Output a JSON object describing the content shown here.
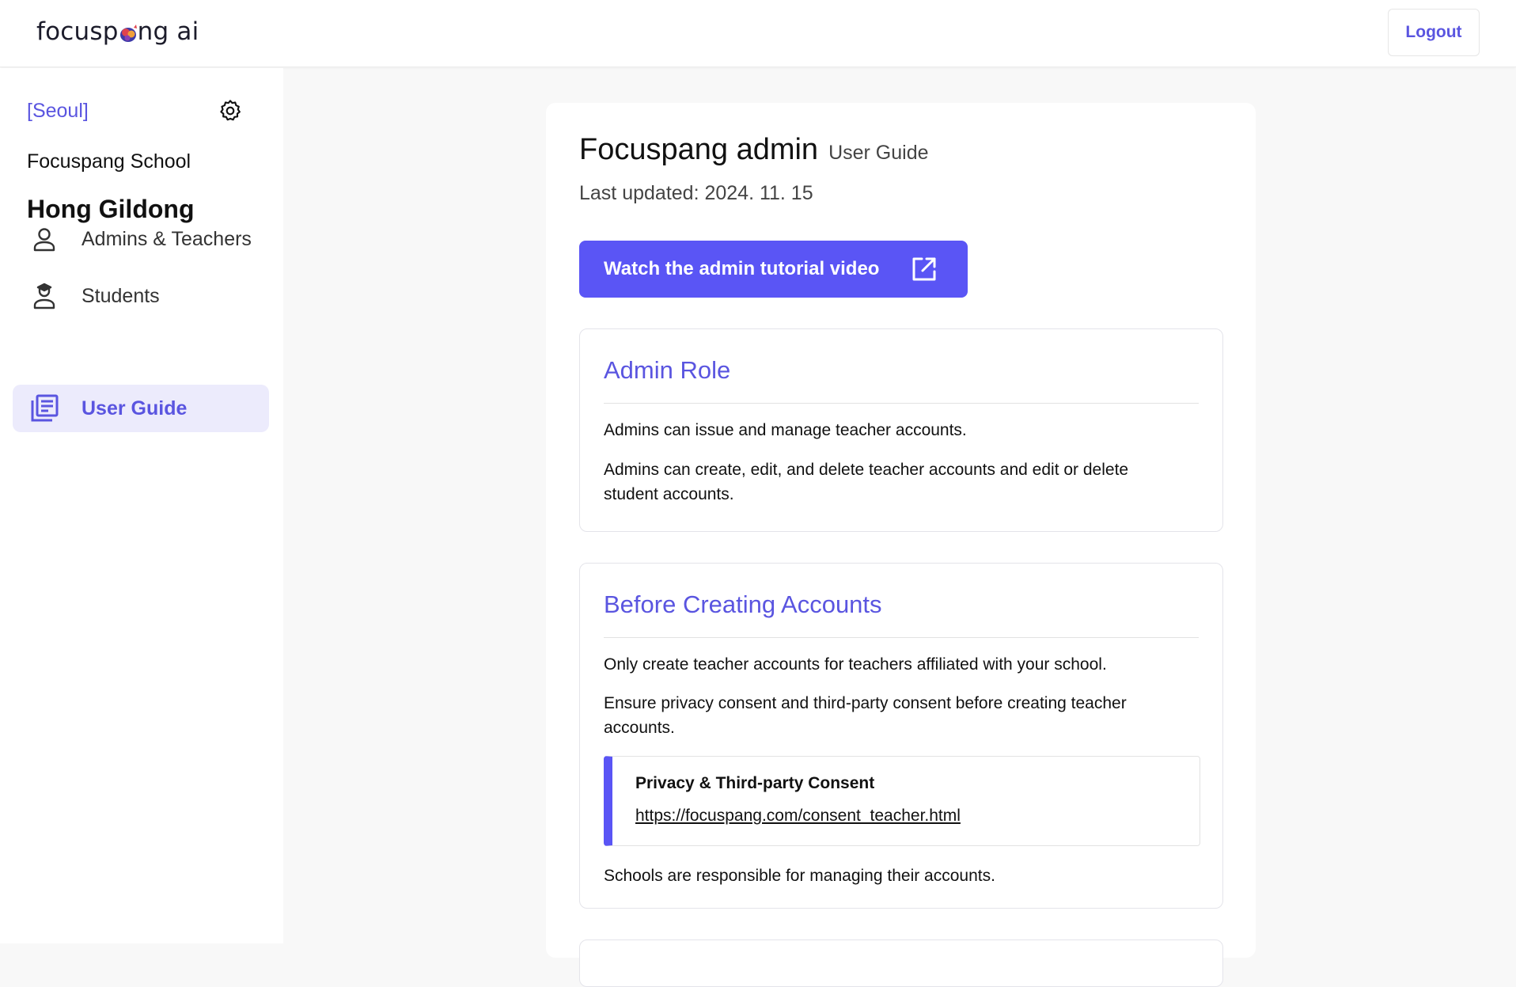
{
  "colors": {
    "accent": "#5a55f5",
    "accent_text": "#5a55e0",
    "active_bg": "#ecebfc",
    "page_bg": "#f8f8f8"
  },
  "header": {
    "logo_text_before": "focusp",
    "logo_text_after": "ng ai",
    "logout_label": "Logout"
  },
  "sidebar": {
    "region": "[Seoul]",
    "settings_icon": "gear-icon",
    "school_name": "Focuspang School",
    "user_name": "Hong Gildong",
    "items": [
      {
        "label": "Admins & Teachers",
        "icon": "user-icon",
        "active": false
      },
      {
        "label": "Students",
        "icon": "graduate-icon",
        "active": false
      },
      {
        "label": "User Guide",
        "icon": "book-icon",
        "active": true
      }
    ]
  },
  "main": {
    "title": "Focuspang admin",
    "subtitle": "User Guide",
    "last_updated": "Last updated: 2024. 11. 15",
    "video_button_label": "Watch the admin tutorial video",
    "sections": [
      {
        "heading": "Admin Role",
        "paragraphs": [
          "Admins can issue and manage teacher accounts.",
          "Admins can create, edit, and delete teacher accounts and edit or delete student accounts."
        ]
      },
      {
        "heading": "Before Creating Accounts",
        "paragraphs": [
          "Only create teacher accounts for teachers affiliated with your school.",
          "Ensure privacy consent and third-party consent before creating teacher accounts.",
          "Schools are responsible for managing their accounts."
        ],
        "consent": {
          "title": "Privacy & Third-party Consent",
          "link": "https://focuspang.com/consent_teacher.html"
        }
      }
    ]
  }
}
